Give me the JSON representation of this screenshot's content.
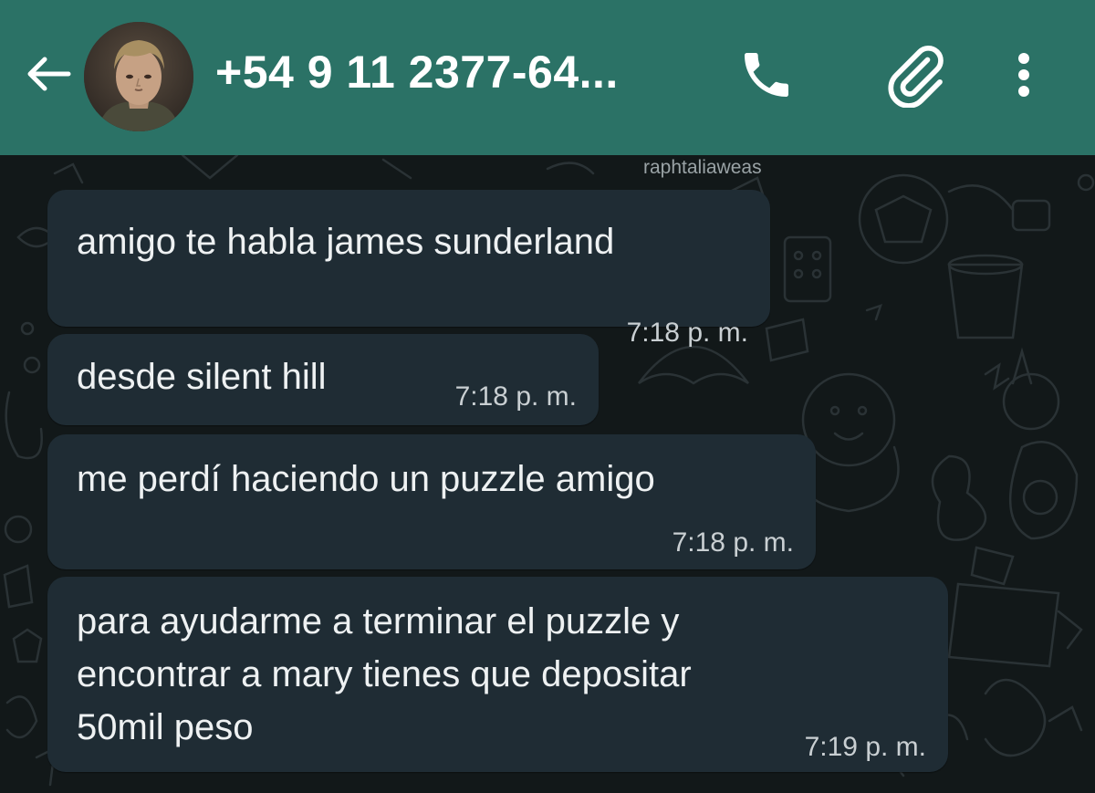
{
  "header": {
    "contact_name": "+54 9 11 2377-64...",
    "background_color": "#2b7266",
    "back_icon": "arrow-left-icon",
    "call_icon": "phone-icon",
    "attach_icon": "paperclip-icon",
    "menu_icon": "more-vertical-icon"
  },
  "watermark": "raphtaliaweas",
  "messages": [
    {
      "lines": [
        "amigo te habla james sunderland"
      ],
      "time": "7:18 p. m."
    },
    {
      "lines": [
        "desde silent hill"
      ],
      "time": "7:18 p. m."
    },
    {
      "lines": [
        "me perdí haciendo un puzzle amigo"
      ],
      "time": "7:18 p. m."
    },
    {
      "lines": [
        "para ayudarme a terminar el puzzle y",
        "encontrar a mary tienes que depositar",
        "50mil peso"
      ],
      "time": "7:19 p. m."
    }
  ],
  "colors": {
    "bubble": "#1f2c34",
    "chat_background": "#121819"
  }
}
